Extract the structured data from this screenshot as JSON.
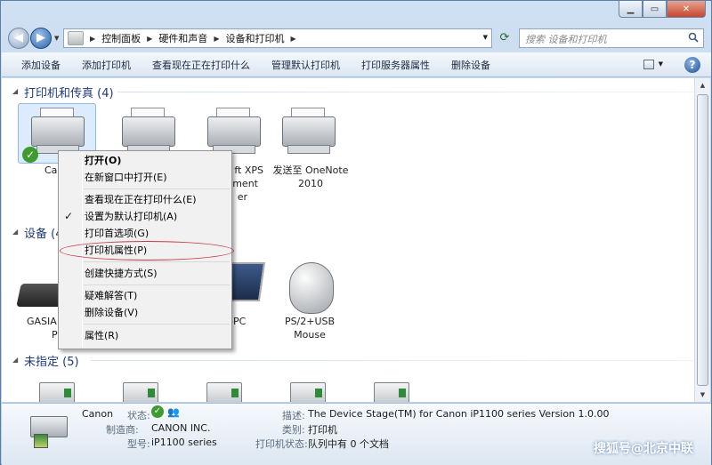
{
  "addressbar": {
    "crumbs": [
      "控制面板",
      "硬件和声音",
      "设备和打印机"
    ],
    "search_placeholder": "搜索 设备和打印机"
  },
  "toolbar": {
    "items": [
      "添加设备",
      "添加打印机",
      "查看现在正在打印什么",
      "管理默认打印机",
      "打印服务器属性",
      "删除设备"
    ],
    "help": "?"
  },
  "groups": {
    "printers": {
      "title": "打印机和传真 (4)"
    },
    "devices": {
      "title": "设备 (4"
    },
    "unspecified": {
      "title": "未指定 (5)"
    }
  },
  "devices": {
    "canon": {
      "label": "Ca"
    },
    "xps": {
      "label_l1": "ft XPS",
      "label_l2": "ment",
      "label_l3": "er"
    },
    "onenote": {
      "label_l1": "发送至 OneNote",
      "label_l2": "2010"
    },
    "gasia": {
      "label_l1": "GASIA",
      "label_l2": "P"
    },
    "pc": {
      "label": "-PC"
    },
    "mouse": {
      "label_l1": "PS/2+USB",
      "label_l2": "Mouse"
    }
  },
  "context_menu": {
    "items": [
      "打开(O)",
      "在新窗口中打开(E)",
      "查看现在正在打印什么(E)",
      "设置为默认打印机(A)",
      "打印首选项(G)",
      "打印机属性(P)",
      "创建快捷方式(S)",
      "疑难解答(T)",
      "删除设备(V)",
      "属性(R)"
    ],
    "check": "✓"
  },
  "details": {
    "name": "Canon",
    "status_label": "状态:",
    "manufacturer_label": "制造商:",
    "manufacturer": "CANON INC.",
    "model_label": "型号:",
    "model": "iP1100 series",
    "desc_label": "描述:",
    "desc": "The Device Stage(TM) for Canon iP1100 series Version 1.0.00",
    "category_label": "类别:",
    "category": "打印机",
    "printstatus_label": "打印机状态:",
    "printstatus": "队列中有 0 个文档"
  },
  "watermark": "搜狐号@北京中联"
}
